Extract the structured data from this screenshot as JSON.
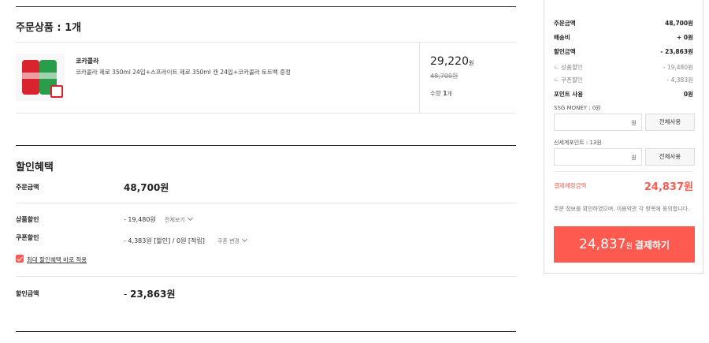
{
  "order_items": {
    "title": "주문상품 : 1개",
    "product": {
      "image_alt": "coke-and-sprite-cans",
      "brand": "코카콜라",
      "name": "코카콜라 제로 350ml 24입+스프라이트 제로 350ml 캔 24입+코카콜라 토트백 증정",
      "price": "29,220",
      "price_unit": "원",
      "original_price": "48,700원",
      "quantity_label": "수량",
      "quantity": "1",
      "quantity_unit": "개"
    }
  },
  "discount": {
    "title": "할인혜택",
    "order_amount_label": "주문금액",
    "order_amount": "48,700원",
    "product_discount_label": "상품할인",
    "product_discount": "- 19,480원",
    "view_all": "전체보기",
    "coupon_discount_label": "쿠폰할인",
    "coupon_discount": "- 4,383원 [할인] / 0원 [적립]",
    "coupon_change": "쿠폰 변경",
    "max_benefit_checkbox": "최대 할인혜택 바로 적용",
    "max_benefit_checked": true,
    "total_discount_label": "할인금액",
    "total_discount_prefix": "- ",
    "total_discount": "23,863원"
  },
  "summary": {
    "order_amount_label": "주문금액",
    "order_amount": "48,700원",
    "shipping_label": "배송비",
    "shipping": "+ 0원",
    "discount_label": "할인금액",
    "discount": "- 23,863원",
    "product_discount_label": "ㄴ 상품할인",
    "product_discount": "- 19,480원",
    "coupon_discount_label": "ㄴ 쿠폰할인",
    "coupon_discount": "- 4,383원",
    "points_label": "포인트 사용",
    "points": "0원",
    "ssg_money_label": "SSG MONEY : 0원",
    "ssg_unit": "원",
    "ssg_use_all": "전체사용",
    "shinsegae_label": "신세계포인트 : 13원",
    "shinsegae_unit": "원",
    "shinsegae_use_all": "전체사용",
    "payment_label": "결제예정금액",
    "payment": "24,837원",
    "agree_text": "주문 정보를 확인하였으며, 이용약관 각 항목에 동의합니다.",
    "pay_amount": "24,837",
    "pay_unit": "원",
    "pay_action": "결제하기"
  },
  "colors": {
    "accent": "#ff5a4f",
    "text": "#222222",
    "border": "#e5e5e5"
  }
}
